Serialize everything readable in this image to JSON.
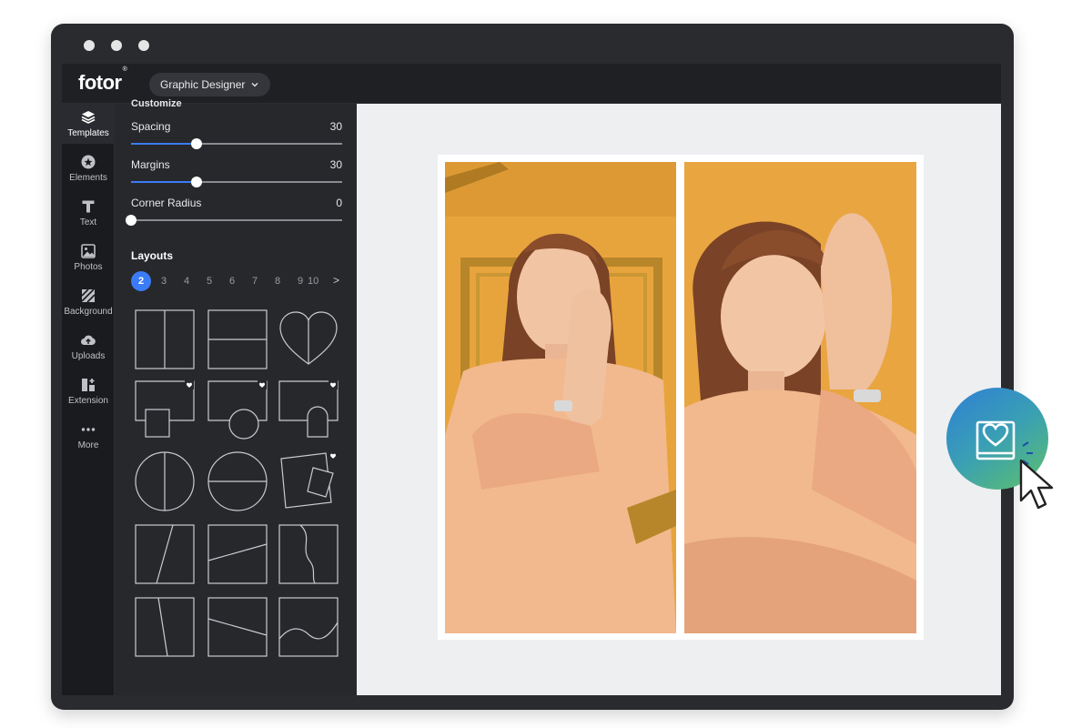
{
  "app": {
    "logo": "fotor",
    "logo_mark": "®",
    "mode_dropdown": "Graphic Designer"
  },
  "sidebar": {
    "items": [
      {
        "label": "Templates",
        "icon": "layers-icon",
        "active": true
      },
      {
        "label": "Elements",
        "icon": "elements-icon"
      },
      {
        "label": "Text",
        "icon": "text-icon"
      },
      {
        "label": "Photos",
        "icon": "photos-icon"
      },
      {
        "label": "Background",
        "icon": "background-icon"
      },
      {
        "label": "Uploads",
        "icon": "upload-cloud-icon"
      },
      {
        "label": "Extension",
        "icon": "extension-icon"
      },
      {
        "label": "More",
        "icon": "more-icon"
      }
    ]
  },
  "panel": {
    "cut_heading": "Customize",
    "sliders": [
      {
        "label": "Spacing",
        "value": "30",
        "fraction": 0.31
      },
      {
        "label": "Margins",
        "value": "30",
        "fraction": 0.31
      },
      {
        "label": "Corner Radius",
        "value": "0",
        "fraction": 0.0
      }
    ],
    "layouts_title": "Layouts",
    "layout_counts": [
      "2",
      "3",
      "4",
      "5",
      "6",
      "7",
      "8",
      "9",
      "10"
    ],
    "active_count": "2",
    "next_arrow": ">"
  },
  "colors": {
    "accent": "#3b7bf6",
    "panel_bg": "#27282c",
    "canvas_bg": "#eeeff1",
    "photo_orange": "#e3a23a"
  },
  "canvas": {
    "photos": [
      "portrait-photo-left",
      "portrait-photo-right"
    ]
  },
  "fab": {
    "icon": "heart-frame-icon"
  }
}
